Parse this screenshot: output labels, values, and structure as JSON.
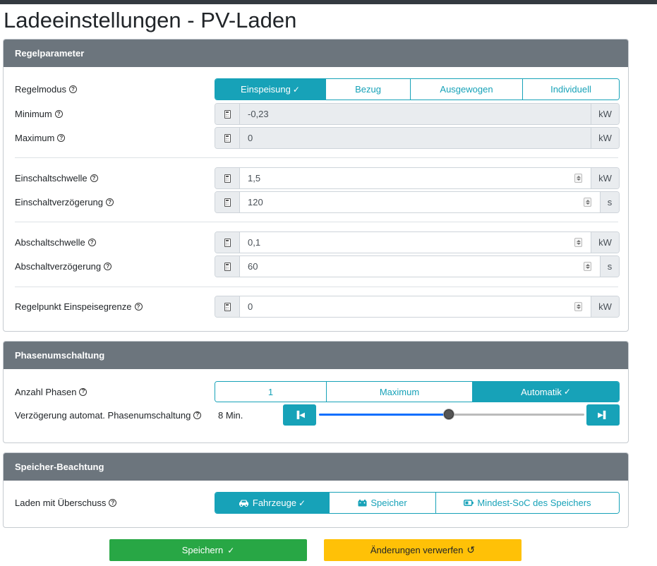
{
  "page": {
    "title": "Ladeeinstellungen - PV-Laden"
  },
  "regelparameter": {
    "header": "Regelparameter",
    "regelmodus": {
      "label": "Regelmodus",
      "options": [
        "Einspeisung",
        "Bezug",
        "Ausgewogen",
        "Individuell"
      ],
      "selected": "Einspeisung"
    },
    "minimum": {
      "label": "Minimum",
      "value": "-0,23",
      "unit": "kW"
    },
    "maximum": {
      "label": "Maximum",
      "value": "0",
      "unit": "kW"
    },
    "einschaltschwelle": {
      "label": "Einschaltschwelle",
      "value": "1,5",
      "unit": "kW"
    },
    "einschaltverzoegerung": {
      "label": "Einschaltverzögerung",
      "value": "120",
      "unit": "s"
    },
    "abschaltschwelle": {
      "label": "Abschaltschwelle",
      "value": "0,1",
      "unit": "kW"
    },
    "abschaltverzoegerung": {
      "label": "Abschaltverzögerung",
      "value": "60",
      "unit": "s"
    },
    "regelpunkt": {
      "label": "Regelpunkt Einspeisegrenze",
      "value": "0",
      "unit": "kW"
    }
  },
  "phasenumschaltung": {
    "header": "Phasenumschaltung",
    "anzahl_phasen": {
      "label": "Anzahl Phasen",
      "options": [
        "1",
        "Maximum",
        "Automatik"
      ],
      "selected": "Automatik"
    },
    "verzoegerung": {
      "label": "Verzögerung automat. Phasenumschaltung",
      "value_text": "8 Min.",
      "slider_fraction": 0.49
    }
  },
  "speicher": {
    "header": "Speicher-Beachtung",
    "laden_mit_ueberschuss": {
      "label": "Laden mit Überschuss",
      "options": [
        {
          "label": "Fahrzeuge",
          "icon": "car-icon"
        },
        {
          "label": "Speicher",
          "icon": "battery-icon"
        },
        {
          "label": "Mindest-SoC des Speichers",
          "icon": "battery-low-icon"
        }
      ],
      "selected": "Fahrzeuge"
    }
  },
  "footer": {
    "save_label": "Speichern",
    "discard_label": "Änderungen verwerfen"
  },
  "colors": {
    "accent": "#17a2b8",
    "header": "#6c757d",
    "save": "#28a745",
    "discard": "#ffc107"
  }
}
